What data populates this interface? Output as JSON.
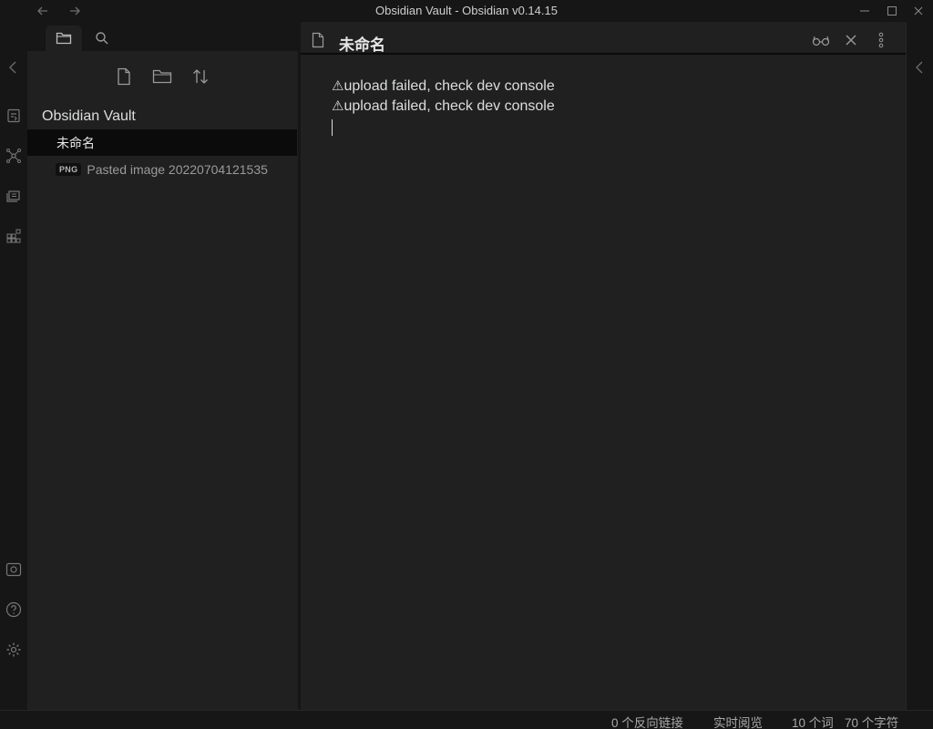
{
  "window": {
    "title": "Obsidian Vault - Obsidian v0.14.15"
  },
  "titlebar": {
    "back_icon": "arrow-left-icon",
    "forward_icon": "arrow-right-icon",
    "minimize_icon": "minimize-icon",
    "maximize_icon": "maximize-icon",
    "close_icon": "close-icon"
  },
  "ribbon": {
    "items": [
      {
        "icon": "collapse-left-icon"
      },
      {
        "icon": "quick-switcher-icon"
      },
      {
        "icon": "graph-view-icon"
      },
      {
        "icon": "slides-icon"
      },
      {
        "icon": "community-plugins-icon"
      },
      {
        "icon": "vault-switcher-icon"
      },
      {
        "icon": "help-icon"
      },
      {
        "icon": "settings-icon"
      }
    ]
  },
  "sidebar": {
    "tabs": [
      {
        "icon": "folder-icon",
        "active": true
      },
      {
        "icon": "search-icon",
        "active": false
      }
    ],
    "nav_buttons": [
      {
        "icon": "new-note-icon"
      },
      {
        "icon": "new-folder-icon"
      },
      {
        "icon": "sort-icon"
      }
    ],
    "vault_name": "Obsidian Vault",
    "files": [
      {
        "name": "未命名",
        "badge": "",
        "selected": true
      },
      {
        "name": "Pasted image 20220704121535",
        "badge": "PNG",
        "selected": false
      }
    ]
  },
  "editor": {
    "header": {
      "file_icon": "file-icon",
      "title": "未命名",
      "reading_view_icon": "glasses-icon",
      "close_icon": "close-icon",
      "more_icon": "more-vertical-icon"
    },
    "lines": [
      {
        "icon": "⚠",
        "text": "upload failed, check dev console"
      },
      {
        "icon": "⚠",
        "text": "upload failed, check dev console"
      }
    ]
  },
  "right_panel": {
    "expand_icon": "chevron-left-icon"
  },
  "statusbar": {
    "backlinks": "0 个反向链接",
    "mode": "实时阅览",
    "words": "10 个词",
    "chars": "70 个字符"
  }
}
